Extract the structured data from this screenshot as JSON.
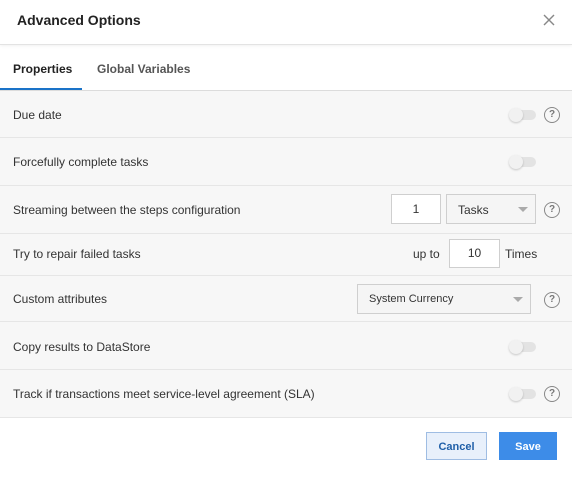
{
  "dialog": {
    "title": "Advanced Options",
    "close_icon": "close-icon"
  },
  "tabs": [
    {
      "label": "Properties",
      "active": true
    },
    {
      "label": "Global Variables",
      "active": false
    }
  ],
  "rows": {
    "due_date": {
      "label": "Due date",
      "enabled": false
    },
    "force_complete": {
      "label": "Forcefully complete tasks",
      "enabled": false
    },
    "streaming": {
      "label": "Streaming between the steps configuration",
      "count": "1",
      "unit": "Tasks"
    },
    "repair": {
      "label": "Try to repair failed tasks",
      "prefix": "up to",
      "count": "10",
      "suffix": "Times"
    },
    "custom_attributes": {
      "label": "Custom attributes",
      "selected": "System Currency"
    },
    "copy_results": {
      "label": "Copy results to DataStore",
      "enabled": false
    },
    "sla": {
      "label": "Track if transactions meet service-level agreement (SLA)",
      "enabled": false
    }
  },
  "help_glyph": "?",
  "buttons": {
    "cancel": "Cancel",
    "save": "Save"
  },
  "colors": {
    "accent": "#3d8ce8",
    "tab_underline": "#1a73c8"
  }
}
